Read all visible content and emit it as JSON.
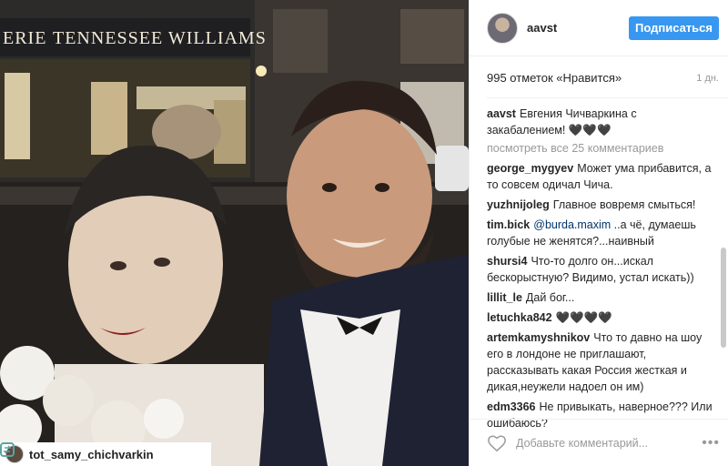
{
  "photo": {
    "sign_left": "ERIE",
    "sign_main": "TENNESSEE WILLIAMS",
    "repost_username": "tot_samy_chichvarkin"
  },
  "header": {
    "username": "aavst",
    "follow_label": "Подписаться"
  },
  "meta": {
    "likes": "995 отметок «Нравится»",
    "time": "1 дн."
  },
  "caption": {
    "author": "aavst",
    "text": "Евгения Чичваркина с закабалением! 🖤🖤🖤"
  },
  "view_all": "посмотреть все 25 комментариев",
  "comments": [
    {
      "author": "george_mygyev",
      "text": "Может ума прибавится, а то совсем одичал Чича."
    },
    {
      "author": "yuzhnijoleg",
      "text": "Главное вовремя смыться!"
    },
    {
      "author": "tim.bick",
      "mention": "@burda.maxim",
      "text": "..а чё, думаешь голубые не женятся?...наивный"
    },
    {
      "author": "shursi4",
      "text": "Что-то долго он...искал бескорыстную? Видимо, устал искать))"
    },
    {
      "author": "lillit_le",
      "text": "Дай бог..."
    },
    {
      "author": "letuchka842",
      "text": "🖤🖤🖤🖤"
    },
    {
      "author": "artemkamyshnikov",
      "text": "Что то давно на шоу его в лондоне не приглашают, рассказывать какая Россия жесткая и дикая,неужели надоел он им)"
    },
    {
      "author": "edm3366",
      "text": "Не привыкать, наверное??? Или ошибаюсь?"
    }
  ],
  "footer": {
    "placeholder": "Добавьте комментарий...",
    "more": "•••"
  }
}
